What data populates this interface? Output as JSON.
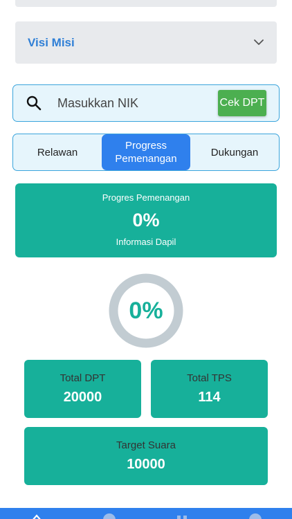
{
  "accordion": {
    "title": "Visi Misi",
    "icon": "chevron-down-icon"
  },
  "search": {
    "placeholder": "Masukkan NIK",
    "value": "",
    "button_label": "Cek DPT",
    "icon": "search-icon"
  },
  "tabs": [
    {
      "label": "Relawan"
    },
    {
      "label_line1": "Progress",
      "label_line2": "Pemenangan"
    },
    {
      "label": "Dukungan"
    }
  ],
  "progress_card": {
    "label": "Progres Pemenangan",
    "value": "0%",
    "sub": "Informasi Dapil"
  },
  "donut": {
    "value_text": "0%",
    "fraction": 0,
    "track_color": "#c2ccd2",
    "fill_color": "#17b09a"
  },
  "stats": {
    "total_dpt": {
      "label": "Total DPT",
      "value": "20000"
    },
    "total_tps": {
      "label": "Total TPS",
      "value": "114"
    },
    "target_suara": {
      "label": "Target Suara",
      "value": "10000"
    }
  },
  "colors": {
    "accent": "#2f80ed",
    "teal": "#17b09a",
    "green": "#4caf50",
    "link": "#2f7fd6"
  }
}
